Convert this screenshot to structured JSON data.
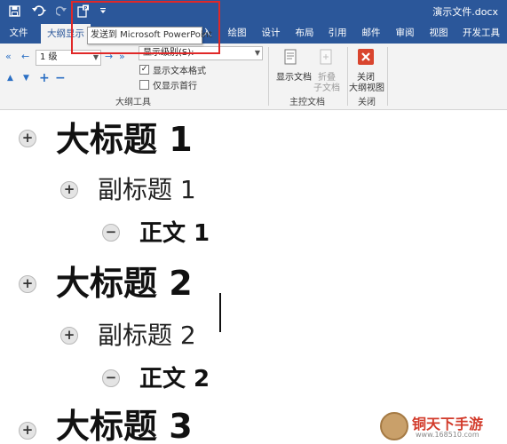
{
  "titlebar": {
    "document_title": "演示文件.docx",
    "quick_access": [
      "save-icon",
      "undo-icon",
      "redo-icon",
      "send-to-ppt-icon",
      "customize-icon"
    ]
  },
  "tabs": [
    {
      "label": "文件",
      "active": false
    },
    {
      "label": "大纲显示",
      "active": true
    },
    {
      "label": "入",
      "active": false
    },
    {
      "label": "绘图",
      "active": false
    },
    {
      "label": "设计",
      "active": false
    },
    {
      "label": "布局",
      "active": false
    },
    {
      "label": "引用",
      "active": false
    },
    {
      "label": "邮件",
      "active": false
    },
    {
      "label": "审阅",
      "active": false
    },
    {
      "label": "视图",
      "active": false
    },
    {
      "label": "开发工具",
      "active": false
    }
  ],
  "tooltip": "发送到 Microsoft PowerPoint",
  "ribbon": {
    "level_select": "1 级",
    "show_level_select": "显示级别(S):",
    "show_text_formatting": {
      "label": "显示文本格式",
      "checked": true
    },
    "show_first_line_only": {
      "label": "仅显示首行",
      "checked": false
    },
    "outline_tools_label": "大纲工具",
    "show_document": "显示文档",
    "collapse_subdocuments_line1": "折叠",
    "collapse_subdocuments_line2": "子文档",
    "master_document_label": "主控文档",
    "close_outline_line1": "关闭",
    "close_outline_line2": "大纲视图",
    "close_label": "关闭",
    "colors": {
      "close_red": "#d9452e",
      "ribbon_blue": "#2b579a"
    }
  },
  "document": {
    "items": [
      {
        "level": 1,
        "text": "大标题 1",
        "toggle": "+"
      },
      {
        "level": 2,
        "text": "副标题 1",
        "toggle": "+"
      },
      {
        "level": 3,
        "text": "正文 1",
        "toggle": "−"
      },
      {
        "level": 1,
        "text": "大标题 2",
        "toggle": "+"
      },
      {
        "level": 2,
        "text": "副标题 2",
        "toggle": "+"
      },
      {
        "level": 3,
        "text": "正文 2",
        "toggle": "−"
      },
      {
        "level": 1,
        "text": "大标题 3",
        "toggle": "+"
      }
    ]
  },
  "watermark": {
    "text": "铜天下手游",
    "url": "www.168510.com"
  }
}
